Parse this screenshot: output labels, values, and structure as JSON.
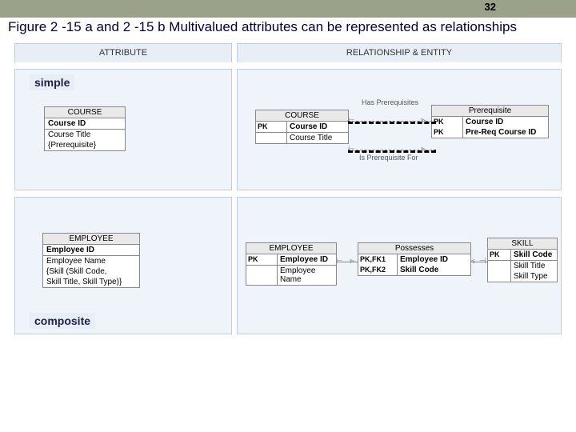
{
  "slide_number": "32",
  "caption": "Figure 2 -15 a and 2 -15 b Multivalued attributes can be represented as relationships",
  "headers": {
    "left": "ATTRIBUTE",
    "right": "RELATIONSHIP & ENTITY"
  },
  "labels": {
    "simple": "simple",
    "composite": "composite"
  },
  "top_left_entity": {
    "title": "COURSE",
    "rows": [
      "Course ID",
      "Course Title",
      "{Prerequisite}"
    ]
  },
  "top_right_course": {
    "title": "COURSE",
    "pk_rows": [
      {
        "pk": "PK",
        "v": "Course ID"
      }
    ],
    "rows": [
      "Course Title"
    ]
  },
  "top_right_prereq": {
    "title": "Prerequisite",
    "pk_rows": [
      {
        "pk": "PK",
        "v": "Course ID"
      },
      {
        "pk": "PK",
        "v": "Pre-Req Course ID"
      }
    ]
  },
  "top_rel_labels": {
    "upper": "Has Prerequisites",
    "lower": "Is Prerequisite For"
  },
  "bottom_left_entity": {
    "title": "EMPLOYEE",
    "rows": [
      "Employee ID",
      "Employee Name",
      "{Skill (Skill Code,",
      "Skill Title, Skill Type)}"
    ]
  },
  "bottom_employee": {
    "title": "EMPLOYEE",
    "pk_rows": [
      {
        "pk": "PK",
        "v": "Employee ID"
      }
    ],
    "rows": [
      "Employee Name"
    ]
  },
  "bottom_assoc": {
    "title": "Possesses",
    "pk_rows": [
      {
        "pk": "PK,FK1",
        "v": "Employee ID"
      },
      {
        "pk": "PK,FK2",
        "v": "Skill Code"
      }
    ]
  },
  "bottom_skill": {
    "title": "SKILL",
    "pk_rows": [
      {
        "pk": "PK",
        "v": "Skill Code"
      }
    ],
    "rows": [
      "Skill Title",
      "Skill Type"
    ]
  }
}
